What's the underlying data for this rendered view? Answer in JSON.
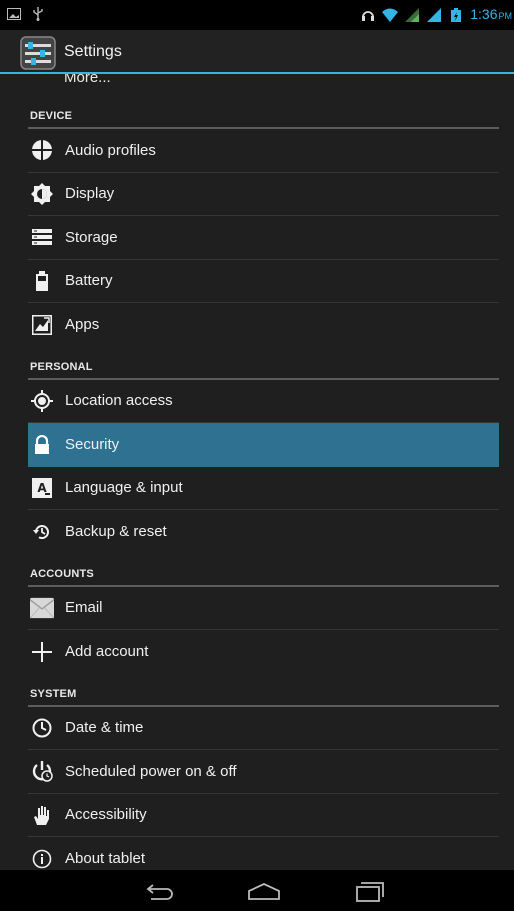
{
  "status_bar": {
    "time": "1:36",
    "ampm": "PM"
  },
  "action_bar": {
    "title": "Settings"
  },
  "partial_item": {
    "label": "More..."
  },
  "sections": [
    {
      "header": "DEVICE",
      "items": [
        {
          "label": "Audio profiles",
          "icon": "audio-profiles-icon"
        },
        {
          "label": "Display",
          "icon": "display-icon"
        },
        {
          "label": "Storage",
          "icon": "storage-icon"
        },
        {
          "label": "Battery",
          "icon": "battery-icon"
        },
        {
          "label": "Apps",
          "icon": "apps-icon"
        }
      ]
    },
    {
      "header": "PERSONAL",
      "items": [
        {
          "label": "Location access",
          "icon": "location-icon"
        },
        {
          "label": "Security",
          "icon": "lock-icon",
          "selected": true
        },
        {
          "label": "Language & input",
          "icon": "language-icon"
        },
        {
          "label": "Backup & reset",
          "icon": "backup-icon"
        }
      ]
    },
    {
      "header": "ACCOUNTS",
      "items": [
        {
          "label": "Email",
          "icon": "email-icon"
        },
        {
          "label": "Add account",
          "icon": "plus-icon"
        }
      ]
    },
    {
      "header": "SYSTEM",
      "items": [
        {
          "label": "Date & time",
          "icon": "clock-icon"
        },
        {
          "label": "Scheduled power on & off",
          "icon": "power-schedule-icon"
        },
        {
          "label": "Accessibility",
          "icon": "hand-icon"
        },
        {
          "label": "About tablet",
          "icon": "info-icon"
        }
      ]
    }
  ],
  "colors": {
    "accent": "#33b5e5",
    "selected_row": "#2e7191",
    "background": "#1f1f20"
  }
}
